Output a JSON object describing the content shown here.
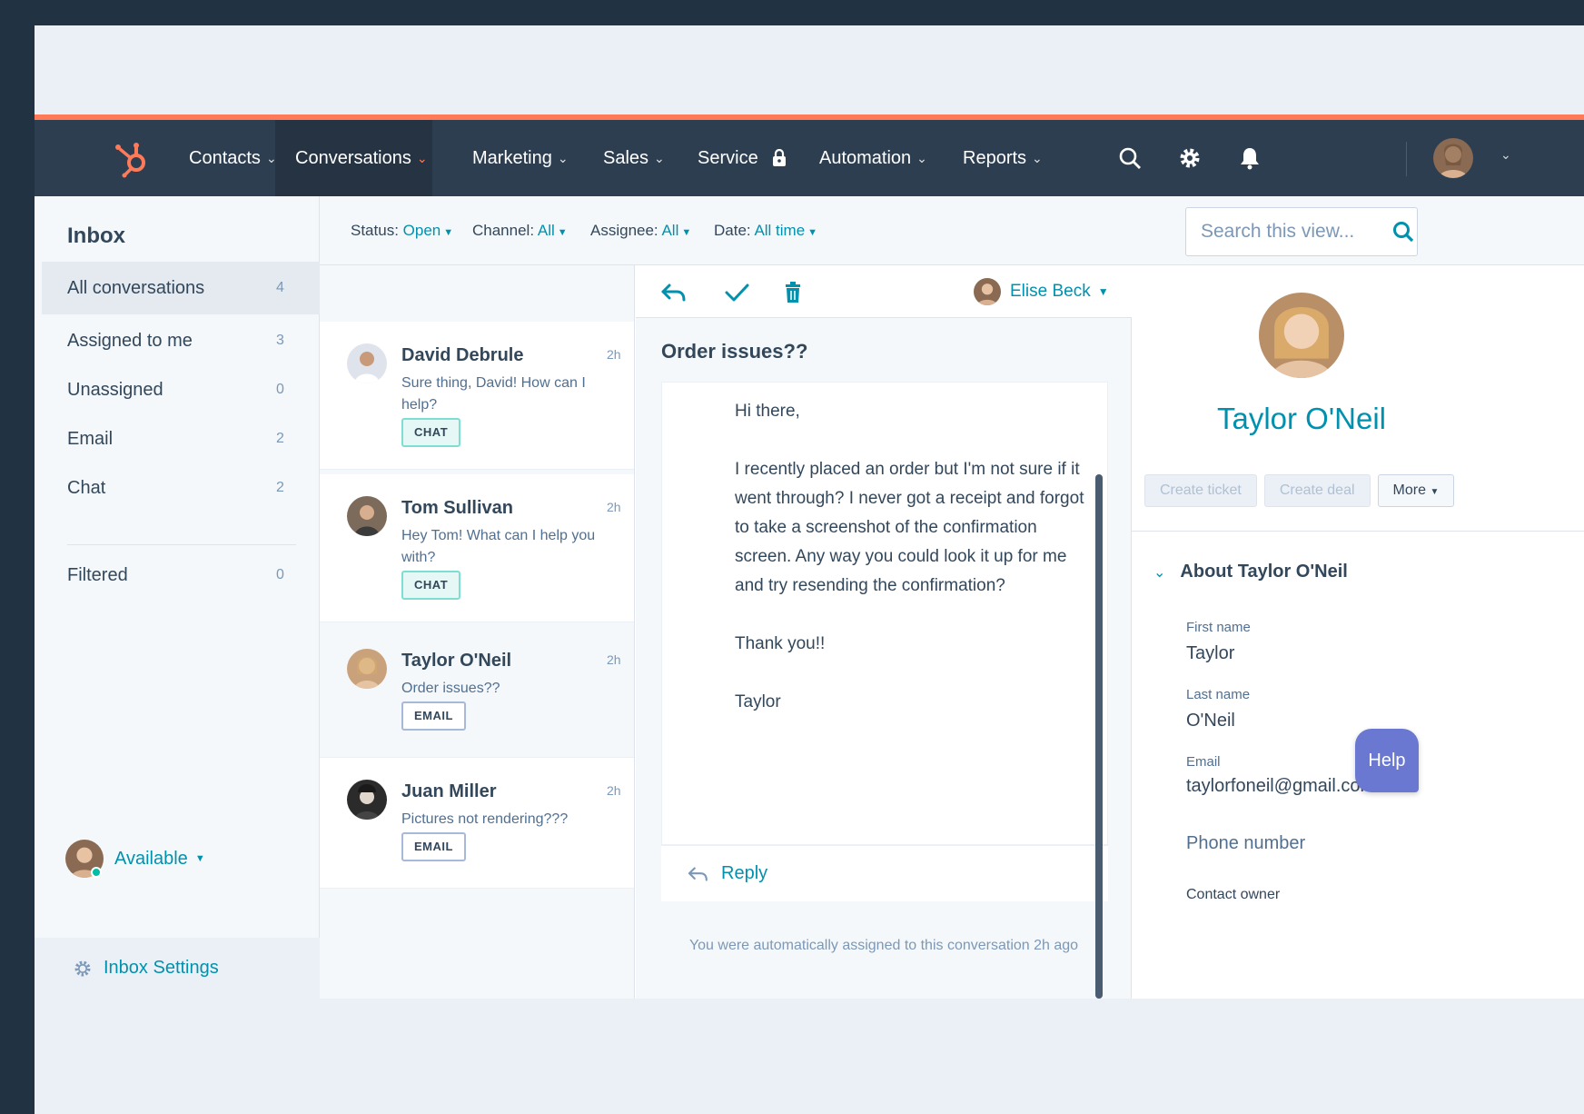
{
  "colors": {
    "accent": "#0091ae",
    "brand_orange": "#ff7a59",
    "nav_bg": "#2d3e50",
    "status_green": "#00bda5",
    "help_bg": "#6a78d1"
  },
  "nav": {
    "items": [
      {
        "label": "Contacts",
        "icon": "chevron-down-icon"
      },
      {
        "label": "Conversations",
        "icon": "chevron-down-icon",
        "active": true
      },
      {
        "label": "Marketing",
        "icon": "chevron-down-icon"
      },
      {
        "label": "Sales",
        "icon": "chevron-down-icon"
      },
      {
        "label": "Service",
        "icon": "lock-icon"
      },
      {
        "label": "Automation",
        "icon": "chevron-down-icon"
      },
      {
        "label": "Reports",
        "icon": "chevron-down-icon"
      }
    ],
    "icons": [
      "hubspot-logo-icon",
      "search-icon",
      "gear-icon",
      "bell-icon",
      "user-avatar"
    ]
  },
  "sidebar": {
    "title": "Inbox",
    "items": [
      {
        "label": "All conversations",
        "count": "4",
        "selected": true
      },
      {
        "label": "Assigned to me",
        "count": "3"
      },
      {
        "label": "Unassigned",
        "count": "0"
      },
      {
        "label": "Email",
        "count": "2"
      },
      {
        "label": "Chat",
        "count": "2"
      },
      {
        "label": "Filtered",
        "count": "0"
      }
    ],
    "status": "Available",
    "settings": "Inbox Settings"
  },
  "filters": {
    "status": {
      "label": "Status:",
      "value": "Open"
    },
    "channel": {
      "label": "Channel:",
      "value": "All"
    },
    "assignee": {
      "label": "Assignee:",
      "value": "All"
    },
    "date": {
      "label": "Date:",
      "value": "All time"
    },
    "search_placeholder": "Search this view..."
  },
  "conversations": [
    {
      "name": "David Debrule",
      "time": "2h",
      "snippet": "Sure thing, David! How can I help?",
      "tag": "CHAT"
    },
    {
      "name": "Tom Sullivan",
      "time": "2h",
      "snippet": "Hey Tom! What can I help you with?",
      "tag": "CHAT"
    },
    {
      "name": "Taylor O'Neil",
      "time": "2h",
      "snippet": "Order issues??",
      "tag": "EMAIL",
      "selected": true
    },
    {
      "name": "Juan Miller",
      "time": "2h",
      "snippet": "Pictures not rendering???",
      "tag": "EMAIL"
    }
  ],
  "message": {
    "assignee": "Elise Beck",
    "subject": "Order issues??",
    "body": [
      "Hi there,",
      "I recently placed an order but I'm not sure if it went through? I never got a receipt and forgot to take a screenshot of the confirmation screen. Any way you could look it up for me and try resending the confirmation?",
      "Thank you!!",
      "Taylor"
    ],
    "reply": "Reply",
    "note": "You were automatically assigned to this conversation 2h ago"
  },
  "contact": {
    "name": "Taylor O'Neil",
    "buttons": {
      "create_ticket": "Create ticket",
      "create_deal": "Create deal",
      "more": "More"
    },
    "about": "About Taylor O'Neil",
    "properties": [
      {
        "label": "First name",
        "value": "Taylor"
      },
      {
        "label": "Last name",
        "value": "O'Neil"
      },
      {
        "label": "Email",
        "value": "taylorfoneil@gmail.com"
      },
      {
        "label": "",
        "value": "Phone number"
      },
      {
        "label": "Contact owner",
        "value": ""
      }
    ]
  },
  "help": "Help"
}
